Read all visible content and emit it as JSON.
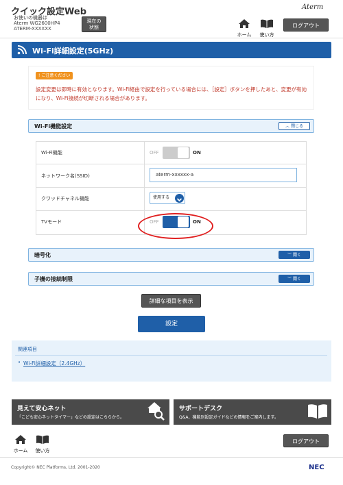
{
  "header": {
    "app_title": "クイック設定Web",
    "device_line1": "お使いの機器は",
    "device_line2": "Aterm WG2600HP4",
    "device_line3": "ATERM-XXXXXX",
    "status_btn_line1": "現在の",
    "status_btn_line2": "状態",
    "brand_logo": "Aterm",
    "nav_home": "ホーム",
    "nav_help": "使い方",
    "logout": "ログアウト"
  },
  "page": {
    "title": "Wi-Fi詳細設定(5GHz)"
  },
  "caution": {
    "badge": "ご注意ください",
    "text": "設定変更は即時に有効となります。Wi-Fi経由で設定を行っている場合には、［設定］ボタンを押したあと、変更が有効になり、Wi-Fi接続が切断される場合があります。"
  },
  "wifi_section": {
    "title": "Wi-Fi機能設定",
    "toggle_label": "閉じる",
    "rows": [
      {
        "label": "Wi-Fi機能",
        "off": "OFF",
        "on": "ON",
        "state": "on-disabled"
      },
      {
        "label": "ネットワーク名(SSID)",
        "value": "aterm-xxxxxx-a"
      },
      {
        "label": "クワッドチャネル機能",
        "value": "使用する"
      },
      {
        "label": "TVモード",
        "off": "OFF",
        "on": "ON",
        "state": "on"
      }
    ]
  },
  "sections": [
    {
      "title": "暗号化",
      "toggle_label": "開く"
    },
    {
      "title": "子機の接続制限",
      "toggle_label": "開く"
    }
  ],
  "actions": {
    "detail": "詳細な項目を表示",
    "save": "設定"
  },
  "related": {
    "title": "関連項目",
    "link": "Wi-Fi詳細設定（2.4GHz）"
  },
  "promos": [
    {
      "title": "見えて安心ネット",
      "sub": "「こども安心ネットタイマー」などの設定はこちらから。",
      "icon": "home-search-icon"
    },
    {
      "title": "サポートデスク",
      "sub": "Q&A、機能別設定ガイドなどの情報をご案内します。",
      "icon": "book-icon"
    }
  ],
  "footer": {
    "nav_home": "ホーム",
    "nav_help": "使い方",
    "logout": "ログアウト",
    "copyright": "Copyright© NEC Platforms, Ltd. 2001-2020",
    "brand": "NEC"
  },
  "colors": {
    "primary": "#1f5fa8",
    "caution_badge": "#f0921e",
    "caution_text": "#c0392b",
    "highlight_ring": "#e02020"
  }
}
